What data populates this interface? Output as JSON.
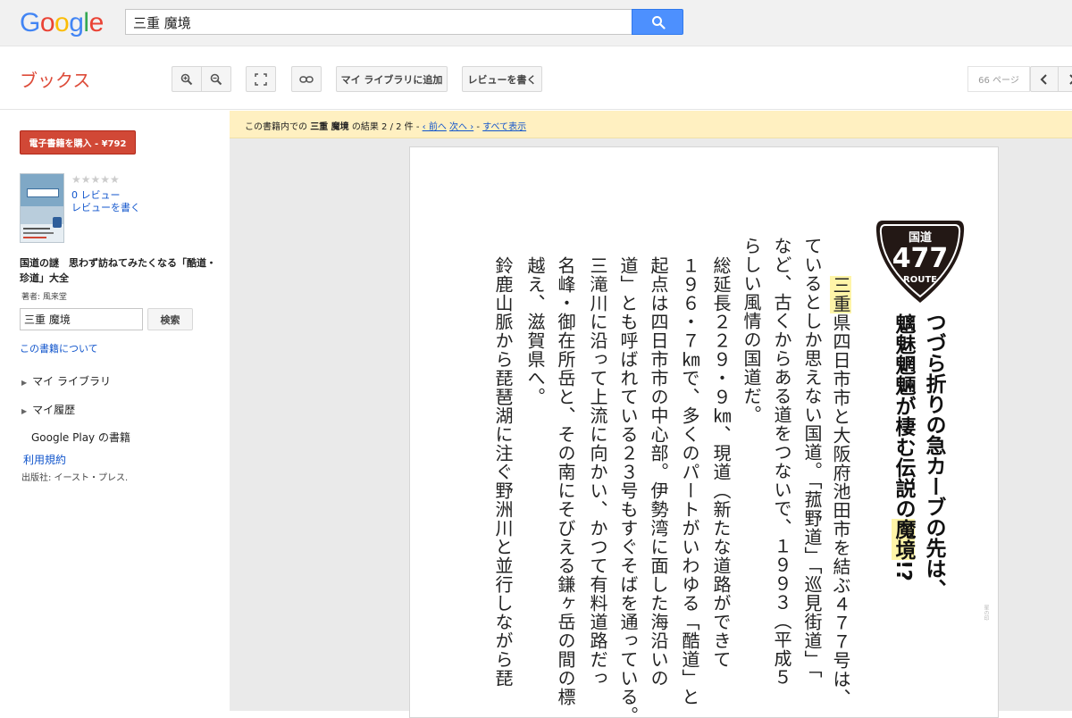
{
  "header": {
    "logo_letters": [
      {
        "ch": "G",
        "color": "#4285f4"
      },
      {
        "ch": "o",
        "color": "#ea4335"
      },
      {
        "ch": "o",
        "color": "#fbbc05"
      },
      {
        "ch": "g",
        "color": "#4285f4"
      },
      {
        "ch": "l",
        "color": "#34a853"
      },
      {
        "ch": "e",
        "color": "#ea4335"
      }
    ],
    "search_value": "三重 魔境"
  },
  "toolbar": {
    "title": "ブックス",
    "add_library": "マイ ライブラリに追加",
    "write_review": "レビューを書く",
    "page_count": "66 ページ"
  },
  "sidebar": {
    "buy_button": "電子書籍を購入 - ¥792",
    "rating_stars": "★★★★★",
    "reviews_count": "0 レビュー",
    "write_review": "レビューを書く",
    "book_title": "国道の謎　思わず訪ねてみたくなる「酷道・珍道」大全",
    "author": "著者: 風来堂",
    "search_value": "三重 魔境",
    "search_button": "検索",
    "about_link": "この書籍について",
    "my_library": "マイ ライブラリ",
    "my_history": "マイ履歴",
    "google_play": "Google Play の書籍",
    "terms": "利用規約",
    "publisher": "出版社: イースト・プレス."
  },
  "result_bar": {
    "prefix": "この書籍内での",
    "query": "三重 魔境",
    "suffix": "の結果 2 / 2 件",
    "prev": "‹ 前へ",
    "next": "次へ ›",
    "show_all": "すべて表示"
  },
  "page_text": {
    "sign_top": "国道",
    "sign_number": "477",
    "sign_bottom": "ROUTE",
    "headline_1": "つづら折りの急カーブの先は、",
    "headline_2_pre": "魑魅魍魎が棲む伝説の",
    "headline_2_hl": "魔境",
    "headline_2_post": "!?",
    "col_1_hl": "三重",
    "col_1": "県四日市市と大阪府池田市を結ぶ４７７号は、",
    "col_2": "ているとしか思えない国道。「菰野道」「巡見街道」「",
    "col_3": "など、古くからある道をつないで、１９９３（平成５",
    "col_4": "らしい風情の国道だ。",
    "col_5": "総延長２２９・９㎞、現道（新たな道路ができて",
    "col_6": "１９６・７㎞で、多くのパートがいわゆる「酷道」と",
    "col_7": "起点は四日市市の中心部。伊勢湾に面した海沿いの",
    "col_8": "道」とも呼ばれている２３号もすぐそばを通っている。",
    "col_9": "三滝川に沿って上流に向かい、かつて有料道路だっ",
    "col_10": "名峰・御在所岳と、その南にそびえる鎌ヶ岳の間の標",
    "col_11": "越え、滋賀県へ。",
    "col_12": "鈴鹿山脈から琵琶湖に注ぐ野洲川と並行しながら琵",
    "page_mark": "星の印"
  }
}
